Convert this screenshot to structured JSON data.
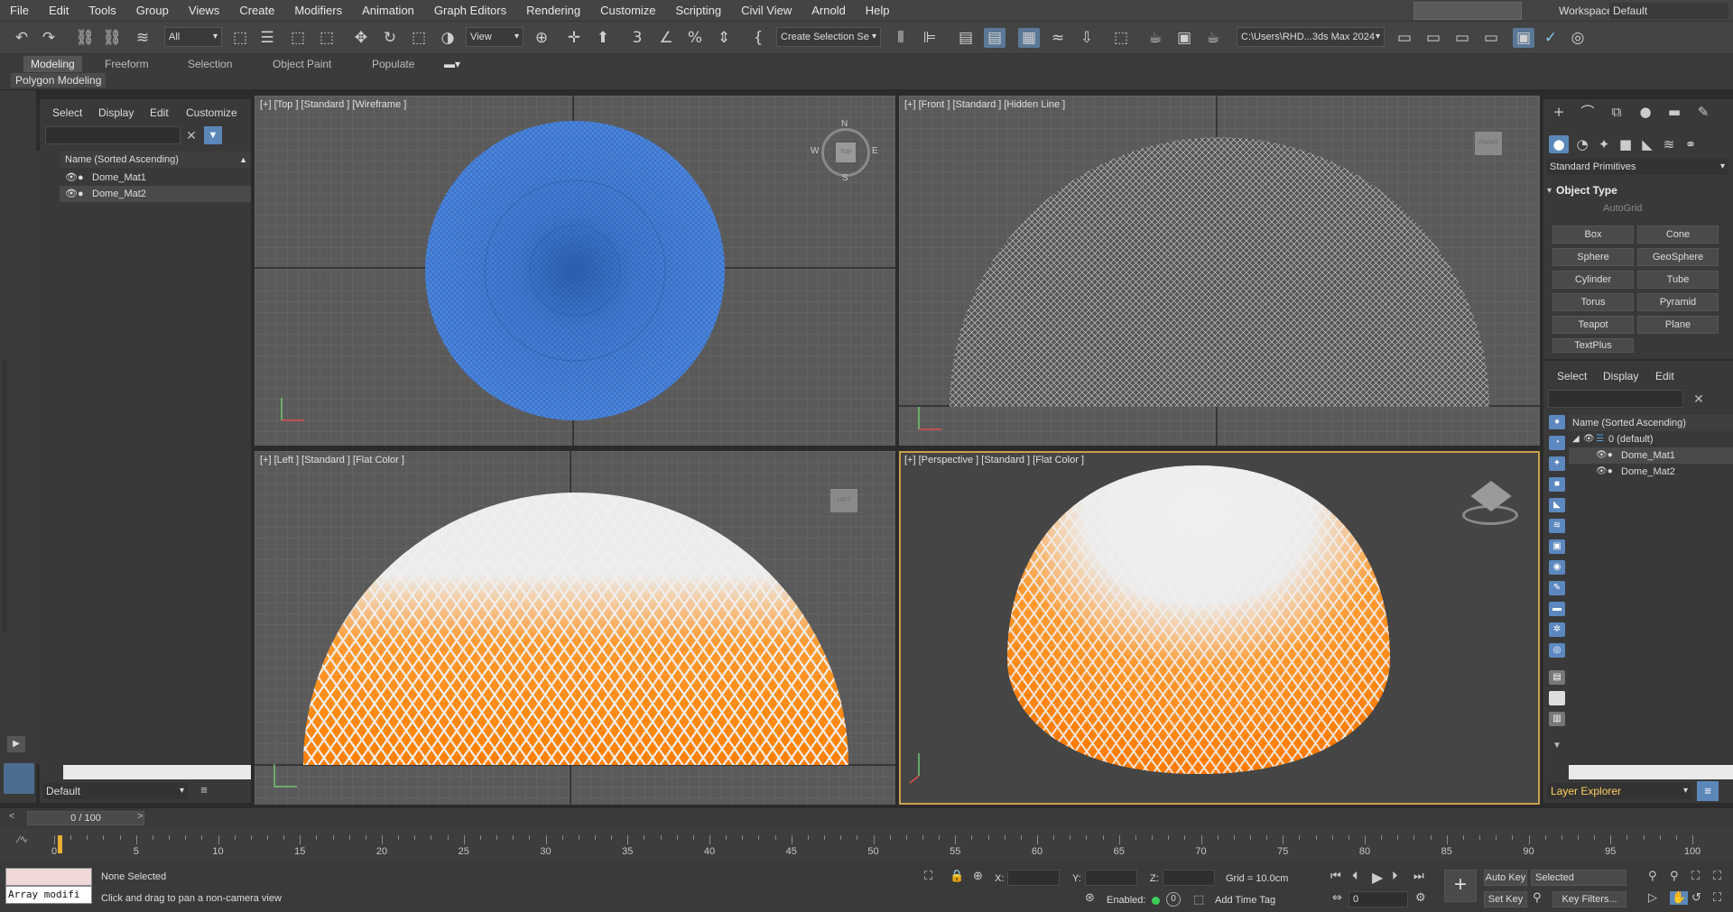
{
  "menu": [
    "File",
    "Edit",
    "Tools",
    "Group",
    "Views",
    "Create",
    "Modifiers",
    "Animation",
    "Graph Editors",
    "Rendering",
    "Customize",
    "Scripting",
    "Civil View",
    "Arnold",
    "Help"
  ],
  "workspaces": {
    "label": "Workspaces:",
    "value": "Default"
  },
  "toolbar": {
    "filter_value": "All",
    "view_value": "View",
    "selection_set": "Create Selection Se",
    "project_path": "C:\\Users\\RHD...3ds Max 2024"
  },
  "ribbon": {
    "tabs": [
      "Modeling",
      "Freeform",
      "Selection",
      "Object Paint",
      "Populate"
    ],
    "active_tab": "Modeling",
    "sub_label": "Polygon Modeling"
  },
  "scene_explorer": {
    "tabs": [
      "Select",
      "Display",
      "Edit",
      "Customize"
    ],
    "header": "Name (Sorted Ascending)",
    "items": [
      "Dome_Mat1",
      "Dome_Mat2"
    ],
    "layer": "Default"
  },
  "viewports": {
    "top": "[+] [Top ] [Standard ] [Wireframe ]",
    "front": "[+] [Front ] [Standard ] [Hidden Line ]",
    "left": "[+] [Left ] [Standard ] [Flat Color ]",
    "perspective": "[+] [Perspective ] [Standard ] [Flat Color ]",
    "compass": {
      "n": "N",
      "s": "S",
      "e": "E",
      "w": "W"
    },
    "viewcube": {
      "top": "TOP",
      "front": "FRONT",
      "left": "LEFT"
    }
  },
  "command_panel": {
    "category": "Standard Primitives",
    "rollout": "Object Type",
    "autogrid": "AutoGrid",
    "primitives": [
      "Box",
      "Cone",
      "Sphere",
      "GeoSphere",
      "Cylinder",
      "Tube",
      "Torus",
      "Pyramid",
      "Teapot",
      "Plane",
      "TextPlus"
    ],
    "layer_tabs": [
      "Select",
      "Display",
      "Edit"
    ],
    "layer_header": "Name (Sorted Ascending)",
    "layer_root": "0 (default)",
    "layer_items": [
      "Dome_Mat1",
      "Dome_Mat2"
    ],
    "layer_explorer": "Layer Explorer"
  },
  "time": {
    "slider": "0 / 100",
    "ticks": [
      0,
      5,
      10,
      15,
      20,
      25,
      30,
      35,
      40,
      45,
      50,
      55,
      60,
      65,
      70,
      75,
      80,
      85,
      90,
      95,
      100
    ]
  },
  "status": {
    "maxscript": "Array modifi",
    "selection": "None Selected",
    "prompt": "Click and drag to pan a non-camera view",
    "x_label": "X:",
    "y_label": "Y:",
    "z_label": "Z:",
    "grid": "Grid = 10.0cm",
    "enabled_label": "Enabled:",
    "enabled_value": "0",
    "add_time_tag": "Add Time Tag",
    "auto_key": "Auto Key",
    "set_key": "Set Key",
    "key_mode": "Selected",
    "key_filters": "Key Filters...",
    "frame": "0"
  },
  "colors": {
    "accent": "#5b7896",
    "dome_orange": "#ff8000",
    "dome_blue": "#4a86e0",
    "active_border": "#c8a24b"
  }
}
